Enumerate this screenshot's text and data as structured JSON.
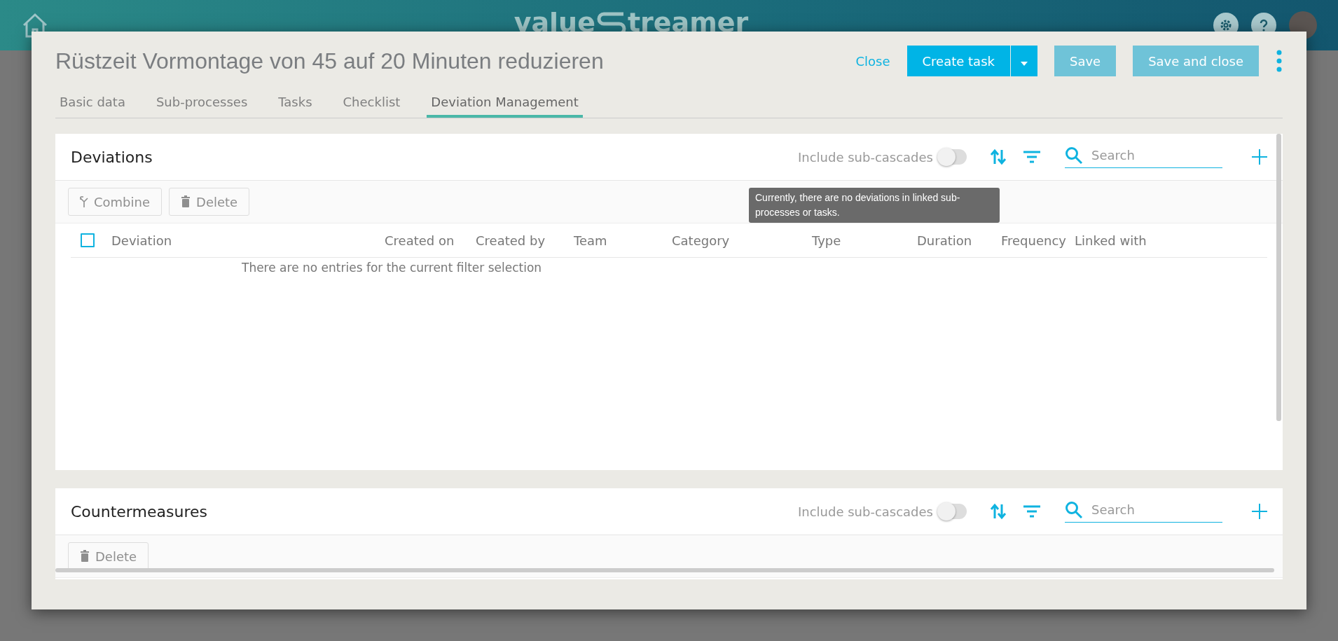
{
  "topbar": {
    "logo_left": "value",
    "logo_right": "treamer"
  },
  "modal": {
    "title": "Rüstzeit Vormontage von 45 auf 20 Minuten reduzieren",
    "actions": [
      {
        "kind": "link",
        "label": "Close",
        "disabled": false
      },
      {
        "kind": "split",
        "label": "Create task",
        "disabled": false
      },
      {
        "kind": "button",
        "label": "Save",
        "disabled": true
      },
      {
        "kind": "button",
        "label": "Save and close",
        "disabled": true
      }
    ],
    "tabs": [
      {
        "label": "Basic data",
        "selected": false
      },
      {
        "label": "Sub-processes",
        "selected": false
      },
      {
        "label": "Tasks",
        "selected": false
      },
      {
        "label": "Checklist",
        "selected": false
      },
      {
        "label": "Deviation Management",
        "selected": true
      }
    ]
  },
  "deviations": {
    "title": "Deviations",
    "toggle": {
      "label": "Include sub-cascades",
      "on": false
    },
    "search": {
      "placeholder": "Search"
    },
    "toolbar": [
      {
        "kind": "combine",
        "label": "Combine",
        "disabled": true
      },
      {
        "kind": "delete",
        "label": "Delete",
        "disabled": true
      }
    ],
    "tooltip": "Currently, there are no deviations in linked sub-processes or tasks.",
    "table": {
      "select_all_checked": false,
      "columns": [
        "Deviation",
        "Created on",
        "Created by",
        "Team",
        "Category",
        "Type",
        "Duration",
        "Frequency",
        "Linked with"
      ],
      "empty_message": "There are no entries for the current filter selection"
    }
  },
  "countermeasures": {
    "title": "Countermeasures",
    "toggle": {
      "label": "Include sub-cascades",
      "on": false
    },
    "search": {
      "placeholder": "Search"
    },
    "toolbar": [
      {
        "kind": "delete",
        "label": "Delete",
        "disabled": true
      }
    ]
  }
}
